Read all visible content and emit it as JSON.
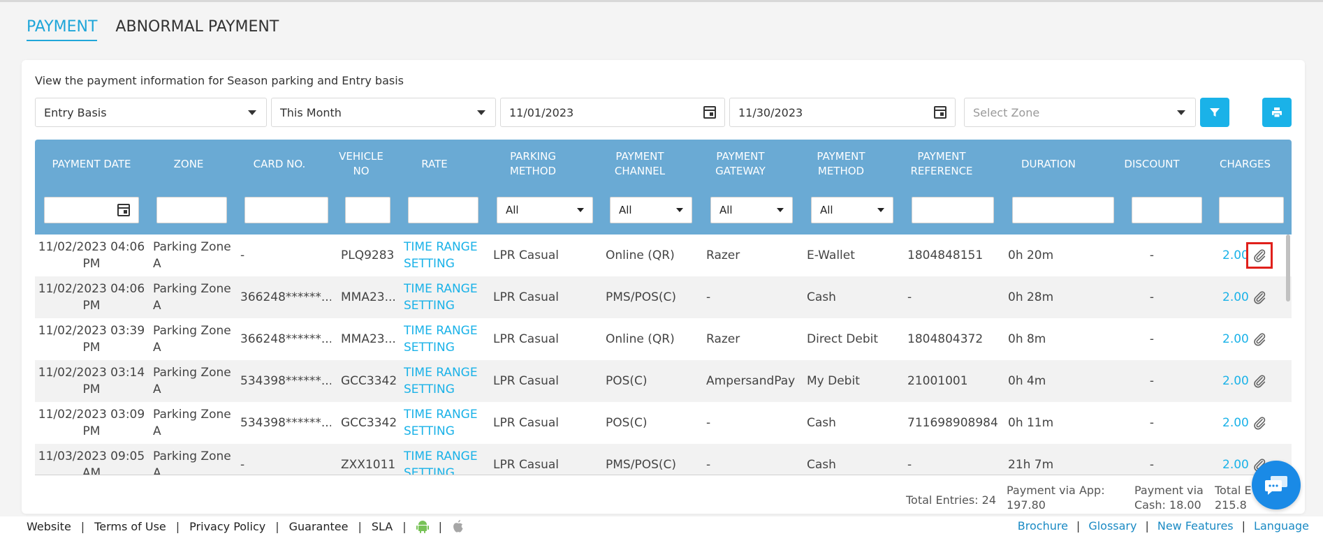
{
  "tabs": [
    {
      "label": "PAYMENT",
      "active": true
    },
    {
      "label": "ABNORMAL PAYMENT",
      "active": false
    }
  ],
  "description": "View the payment information for Season parking and Entry basis",
  "filters": {
    "type": "Entry Basis",
    "period": "This Month",
    "start_date": "11/01/2023",
    "end_date": "11/30/2023",
    "zone_placeholder": "Select Zone"
  },
  "icons": {
    "filter": "filter-icon",
    "print": "print-icon",
    "calendar": "calendar-icon",
    "attachment": "paperclip-icon",
    "chat": "chat-icon",
    "android": "android-icon",
    "apple": "apple-icon"
  },
  "colors": {
    "accent": "#1ab2e8",
    "header": "#6aaad4",
    "highlight": "#e0201b",
    "android": "#78c257",
    "apple": "#a6a6a6"
  },
  "columns": [
    {
      "l1": "PAYMENT DATE",
      "l2": ""
    },
    {
      "l1": "ZONE",
      "l2": ""
    },
    {
      "l1": "CARD NO.",
      "l2": ""
    },
    {
      "l1": "VEHICLE",
      "l2": "NO"
    },
    {
      "l1": "RATE",
      "l2": ""
    },
    {
      "l1": "PARKING",
      "l2": "METHOD"
    },
    {
      "l1": "PAYMENT",
      "l2": "CHANNEL"
    },
    {
      "l1": "PAYMENT",
      "l2": "GATEWAY"
    },
    {
      "l1": "PAYMENT",
      "l2": "METHOD"
    },
    {
      "l1": "PAYMENT",
      "l2": "REFERENCE"
    },
    {
      "l1": "DURATION",
      "l2": ""
    },
    {
      "l1": "DISCOUNT",
      "l2": ""
    },
    {
      "l1": "CHARGES",
      "l2": ""
    }
  ],
  "column_filters": {
    "parking_method": "All",
    "payment_channel": "All",
    "payment_gateway": "All",
    "payment_method": "All"
  },
  "rows": [
    {
      "date1": "11/02/2023 04:06",
      "date2": "PM",
      "zone1": "Parking Zone",
      "zone2": "A",
      "card": "-",
      "vehicle": "PLQ9283",
      "rate1": "TIME RANGE",
      "rate2": "SETTING",
      "method": "LPR Casual",
      "channel": "Online (QR)",
      "gateway": "Razer",
      "pay_method": "E-Wallet",
      "reference": "1804848151",
      "duration": "0h 20m",
      "discount": "-",
      "charges": "2.00"
    },
    {
      "date1": "11/02/2023 04:06",
      "date2": "PM",
      "zone1": "Parking Zone",
      "zone2": "A",
      "card": "366248******...",
      "vehicle": "MMA23...",
      "rate1": "TIME RANGE",
      "rate2": "SETTING",
      "method": "LPR Casual",
      "channel": "PMS/POS(C)",
      "gateway": "-",
      "pay_method": "Cash",
      "reference": "-",
      "duration": "0h 28m",
      "discount": "-",
      "charges": "2.00"
    },
    {
      "date1": "11/02/2023 03:39",
      "date2": "PM",
      "zone1": "Parking Zone",
      "zone2": "A",
      "card": "366248******...",
      "vehicle": "MMA23...",
      "rate1": "TIME RANGE",
      "rate2": "SETTING",
      "method": "LPR Casual",
      "channel": "Online (QR)",
      "gateway": "Razer",
      "pay_method": "Direct Debit",
      "reference": "1804804372",
      "duration": "0h 8m",
      "discount": "-",
      "charges": "2.00"
    },
    {
      "date1": "11/02/2023 03:14",
      "date2": "PM",
      "zone1": "Parking Zone",
      "zone2": "A",
      "card": "534398******...",
      "vehicle": "GCC3342",
      "rate1": "TIME RANGE",
      "rate2": "SETTING",
      "method": "LPR Casual",
      "channel": "POS(C)",
      "gateway": "AmpersandPay",
      "pay_method": "My Debit",
      "reference": "21001001",
      "duration": "0h 4m",
      "discount": "-",
      "charges": "2.00"
    },
    {
      "date1": "11/02/2023 03:09",
      "date2": "PM",
      "zone1": "Parking Zone",
      "zone2": "A",
      "card": "534398******...",
      "vehicle": "GCC3342",
      "rate1": "TIME RANGE",
      "rate2": "SETTING",
      "method": "LPR Casual",
      "channel": "POS(C)",
      "gateway": "-",
      "pay_method": "Cash",
      "reference": "711698908984",
      "duration": "0h 11m",
      "discount": "-",
      "charges": "2.00"
    },
    {
      "date1": "11/03/2023 09:05",
      "date2": "AM",
      "zone1": "Parking Zone",
      "zone2": "A",
      "card": "-",
      "vehicle": "ZXX1011",
      "rate1": "TIME RANGE",
      "rate2": "SETTING",
      "method": "LPR Casual",
      "channel": "PMS/POS(C)",
      "gateway": "-",
      "pay_method": "Cash",
      "reference": "-",
      "duration": "21h 7m",
      "discount": "-",
      "charges": "2.00"
    }
  ],
  "totals": {
    "entries": "Total Entries: 24",
    "app_l1": "Payment via App:",
    "app_l2": "197.80",
    "cash_l1": "Payment via",
    "cash_l2": "Cash: 18.00",
    "total_l1": "Total E",
    "total_l2": "215.8"
  },
  "footer": {
    "left": [
      "Website",
      "Terms of Use",
      "Privacy Policy",
      "Guarantee",
      "SLA"
    ],
    "right": [
      "Brochure",
      "Glossary",
      "New Features",
      "Language"
    ],
    "separator": "|"
  }
}
